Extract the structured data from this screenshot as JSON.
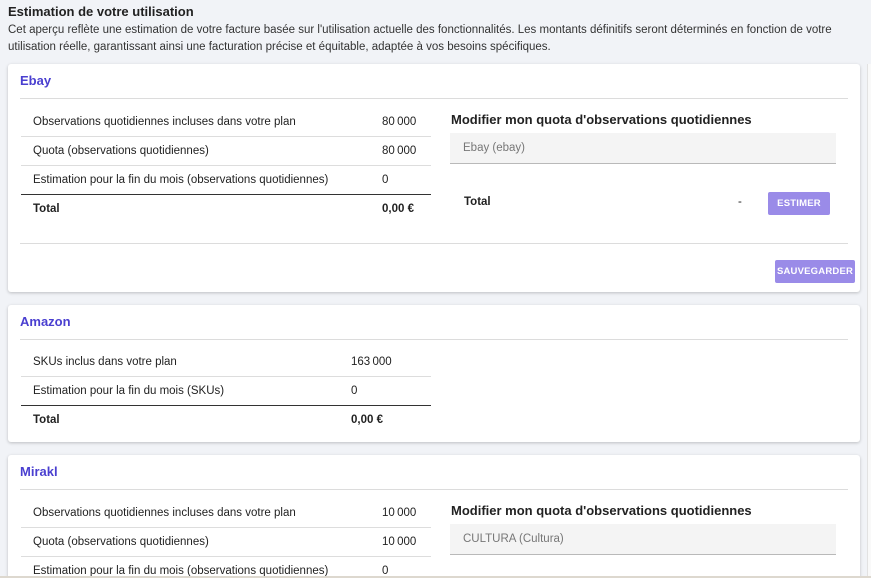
{
  "page": {
    "title": "Estimation de votre utilisation",
    "description": "Cet aperçu reflète une estimation de votre facture basée sur l'utilisation actuelle des fonctionnalités. Les montants définitifs seront déterminés en fonction de votre utilisation réelle, garantissant ainsi une facturation précise et équitable, adaptée à vos besoins spécifiques."
  },
  "ebay": {
    "title": "Ebay",
    "rows": [
      {
        "label": "Observations quotidiennes incluses dans votre plan",
        "value": "80 000"
      },
      {
        "label": "Quota (observations quotidiennes)",
        "value": "80 000"
      },
      {
        "label": "Estimation pour la fin du mois (observations quotidiennes)",
        "value": "0"
      },
      {
        "label": "Total",
        "value": "0,00 €"
      }
    ],
    "quota_title": "Modifier mon quota d'observations quotidiennes",
    "quota_select_value": "Ebay (ebay)",
    "total_label": "Total",
    "total_value": "-",
    "estimate_button": "ESTIMER",
    "save_button": "SAUVEGARDER"
  },
  "amazon": {
    "title": "Amazon",
    "rows": [
      {
        "label": "SKUs inclus dans votre plan",
        "value": "163 000"
      },
      {
        "label": "Estimation pour la fin du mois (SKUs)",
        "value": "0"
      },
      {
        "label": "Total",
        "value": "0,00 €"
      }
    ]
  },
  "mirakl": {
    "title": "Mirakl",
    "rows": [
      {
        "label": "Observations quotidiennes incluses dans votre plan",
        "value": "10 000"
      },
      {
        "label": "Quota (observations quotidiennes)",
        "value": "10 000"
      },
      {
        "label": "Estimation pour la fin du mois (observations quotidiennes)",
        "value": "0"
      }
    ],
    "quota_title": "Modifier mon quota d'observations quotidiennes",
    "quota_select_value": "CULTURA (Cultura)"
  },
  "colors": {
    "accent": "#4a3fd0",
    "button": "#9a8be8",
    "background": "#f1f3f7"
  }
}
